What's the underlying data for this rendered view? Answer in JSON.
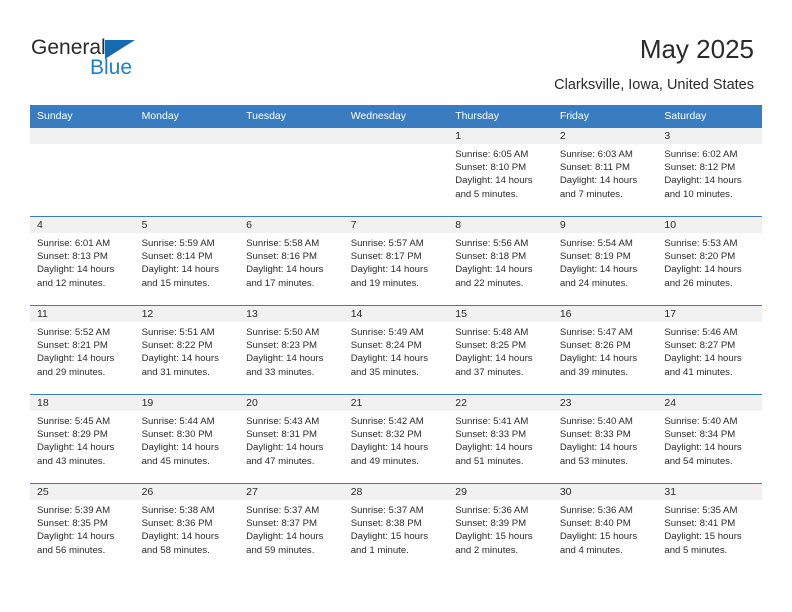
{
  "brand": {
    "name_part1": "General",
    "name_part2": "Blue",
    "triangle_icon": "blue-triangle-logo-icon",
    "accent_color": "#1a7fd4"
  },
  "header": {
    "title": "May 2025",
    "subtitle": "Clarksville, Iowa, United States"
  },
  "theme": {
    "header_row_color": "#3a7cc0",
    "daynum_band_color": "#f1f1f1",
    "text_color": "#2b2b2b"
  },
  "calendar": {
    "weekday_headers": [
      "Sunday",
      "Monday",
      "Tuesday",
      "Wednesday",
      "Thursday",
      "Friday",
      "Saturday"
    ],
    "weeks": [
      [
        {
          "day": "",
          "sunrise": "",
          "sunset": "",
          "daylight_line1": "",
          "daylight_line2": ""
        },
        {
          "day": "",
          "sunrise": "",
          "sunset": "",
          "daylight_line1": "",
          "daylight_line2": ""
        },
        {
          "day": "",
          "sunrise": "",
          "sunset": "",
          "daylight_line1": "",
          "daylight_line2": ""
        },
        {
          "day": "",
          "sunrise": "",
          "sunset": "",
          "daylight_line1": "",
          "daylight_line2": ""
        },
        {
          "day": "1",
          "sunrise": "Sunrise: 6:05 AM",
          "sunset": "Sunset: 8:10 PM",
          "daylight_line1": "Daylight: 14 hours",
          "daylight_line2": "and 5 minutes."
        },
        {
          "day": "2",
          "sunrise": "Sunrise: 6:03 AM",
          "sunset": "Sunset: 8:11 PM",
          "daylight_line1": "Daylight: 14 hours",
          "daylight_line2": "and 7 minutes."
        },
        {
          "day": "3",
          "sunrise": "Sunrise: 6:02 AM",
          "sunset": "Sunset: 8:12 PM",
          "daylight_line1": "Daylight: 14 hours",
          "daylight_line2": "and 10 minutes."
        }
      ],
      [
        {
          "day": "4",
          "sunrise": "Sunrise: 6:01 AM",
          "sunset": "Sunset: 8:13 PM",
          "daylight_line1": "Daylight: 14 hours",
          "daylight_line2": "and 12 minutes."
        },
        {
          "day": "5",
          "sunrise": "Sunrise: 5:59 AM",
          "sunset": "Sunset: 8:14 PM",
          "daylight_line1": "Daylight: 14 hours",
          "daylight_line2": "and 15 minutes."
        },
        {
          "day": "6",
          "sunrise": "Sunrise: 5:58 AM",
          "sunset": "Sunset: 8:16 PM",
          "daylight_line1": "Daylight: 14 hours",
          "daylight_line2": "and 17 minutes."
        },
        {
          "day": "7",
          "sunrise": "Sunrise: 5:57 AM",
          "sunset": "Sunset: 8:17 PM",
          "daylight_line1": "Daylight: 14 hours",
          "daylight_line2": "and 19 minutes."
        },
        {
          "day": "8",
          "sunrise": "Sunrise: 5:56 AM",
          "sunset": "Sunset: 8:18 PM",
          "daylight_line1": "Daylight: 14 hours",
          "daylight_line2": "and 22 minutes."
        },
        {
          "day": "9",
          "sunrise": "Sunrise: 5:54 AM",
          "sunset": "Sunset: 8:19 PM",
          "daylight_line1": "Daylight: 14 hours",
          "daylight_line2": "and 24 minutes."
        },
        {
          "day": "10",
          "sunrise": "Sunrise: 5:53 AM",
          "sunset": "Sunset: 8:20 PM",
          "daylight_line1": "Daylight: 14 hours",
          "daylight_line2": "and 26 minutes."
        }
      ],
      [
        {
          "day": "11",
          "sunrise": "Sunrise: 5:52 AM",
          "sunset": "Sunset: 8:21 PM",
          "daylight_line1": "Daylight: 14 hours",
          "daylight_line2": "and 29 minutes."
        },
        {
          "day": "12",
          "sunrise": "Sunrise: 5:51 AM",
          "sunset": "Sunset: 8:22 PM",
          "daylight_line1": "Daylight: 14 hours",
          "daylight_line2": "and 31 minutes."
        },
        {
          "day": "13",
          "sunrise": "Sunrise: 5:50 AM",
          "sunset": "Sunset: 8:23 PM",
          "daylight_line1": "Daylight: 14 hours",
          "daylight_line2": "and 33 minutes."
        },
        {
          "day": "14",
          "sunrise": "Sunrise: 5:49 AM",
          "sunset": "Sunset: 8:24 PM",
          "daylight_line1": "Daylight: 14 hours",
          "daylight_line2": "and 35 minutes."
        },
        {
          "day": "15",
          "sunrise": "Sunrise: 5:48 AM",
          "sunset": "Sunset: 8:25 PM",
          "daylight_line1": "Daylight: 14 hours",
          "daylight_line2": "and 37 minutes."
        },
        {
          "day": "16",
          "sunrise": "Sunrise: 5:47 AM",
          "sunset": "Sunset: 8:26 PM",
          "daylight_line1": "Daylight: 14 hours",
          "daylight_line2": "and 39 minutes."
        },
        {
          "day": "17",
          "sunrise": "Sunrise: 5:46 AM",
          "sunset": "Sunset: 8:27 PM",
          "daylight_line1": "Daylight: 14 hours",
          "daylight_line2": "and 41 minutes."
        }
      ],
      [
        {
          "day": "18",
          "sunrise": "Sunrise: 5:45 AM",
          "sunset": "Sunset: 8:29 PM",
          "daylight_line1": "Daylight: 14 hours",
          "daylight_line2": "and 43 minutes."
        },
        {
          "day": "19",
          "sunrise": "Sunrise: 5:44 AM",
          "sunset": "Sunset: 8:30 PM",
          "daylight_line1": "Daylight: 14 hours",
          "daylight_line2": "and 45 minutes."
        },
        {
          "day": "20",
          "sunrise": "Sunrise: 5:43 AM",
          "sunset": "Sunset: 8:31 PM",
          "daylight_line1": "Daylight: 14 hours",
          "daylight_line2": "and 47 minutes."
        },
        {
          "day": "21",
          "sunrise": "Sunrise: 5:42 AM",
          "sunset": "Sunset: 8:32 PM",
          "daylight_line1": "Daylight: 14 hours",
          "daylight_line2": "and 49 minutes."
        },
        {
          "day": "22",
          "sunrise": "Sunrise: 5:41 AM",
          "sunset": "Sunset: 8:33 PM",
          "daylight_line1": "Daylight: 14 hours",
          "daylight_line2": "and 51 minutes."
        },
        {
          "day": "23",
          "sunrise": "Sunrise: 5:40 AM",
          "sunset": "Sunset: 8:33 PM",
          "daylight_line1": "Daylight: 14 hours",
          "daylight_line2": "and 53 minutes."
        },
        {
          "day": "24",
          "sunrise": "Sunrise: 5:40 AM",
          "sunset": "Sunset: 8:34 PM",
          "daylight_line1": "Daylight: 14 hours",
          "daylight_line2": "and 54 minutes."
        }
      ],
      [
        {
          "day": "25",
          "sunrise": "Sunrise: 5:39 AM",
          "sunset": "Sunset: 8:35 PM",
          "daylight_line1": "Daylight: 14 hours",
          "daylight_line2": "and 56 minutes."
        },
        {
          "day": "26",
          "sunrise": "Sunrise: 5:38 AM",
          "sunset": "Sunset: 8:36 PM",
          "daylight_line1": "Daylight: 14 hours",
          "daylight_line2": "and 58 minutes."
        },
        {
          "day": "27",
          "sunrise": "Sunrise: 5:37 AM",
          "sunset": "Sunset: 8:37 PM",
          "daylight_line1": "Daylight: 14 hours",
          "daylight_line2": "and 59 minutes."
        },
        {
          "day": "28",
          "sunrise": "Sunrise: 5:37 AM",
          "sunset": "Sunset: 8:38 PM",
          "daylight_line1": "Daylight: 15 hours",
          "daylight_line2": "and 1 minute."
        },
        {
          "day": "29",
          "sunrise": "Sunrise: 5:36 AM",
          "sunset": "Sunset: 8:39 PM",
          "daylight_line1": "Daylight: 15 hours",
          "daylight_line2": "and 2 minutes."
        },
        {
          "day": "30",
          "sunrise": "Sunrise: 5:36 AM",
          "sunset": "Sunset: 8:40 PM",
          "daylight_line1": "Daylight: 15 hours",
          "daylight_line2": "and 4 minutes."
        },
        {
          "day": "31",
          "sunrise": "Sunrise: 5:35 AM",
          "sunset": "Sunset: 8:41 PM",
          "daylight_line1": "Daylight: 15 hours",
          "daylight_line2": "and 5 minutes."
        }
      ]
    ]
  }
}
